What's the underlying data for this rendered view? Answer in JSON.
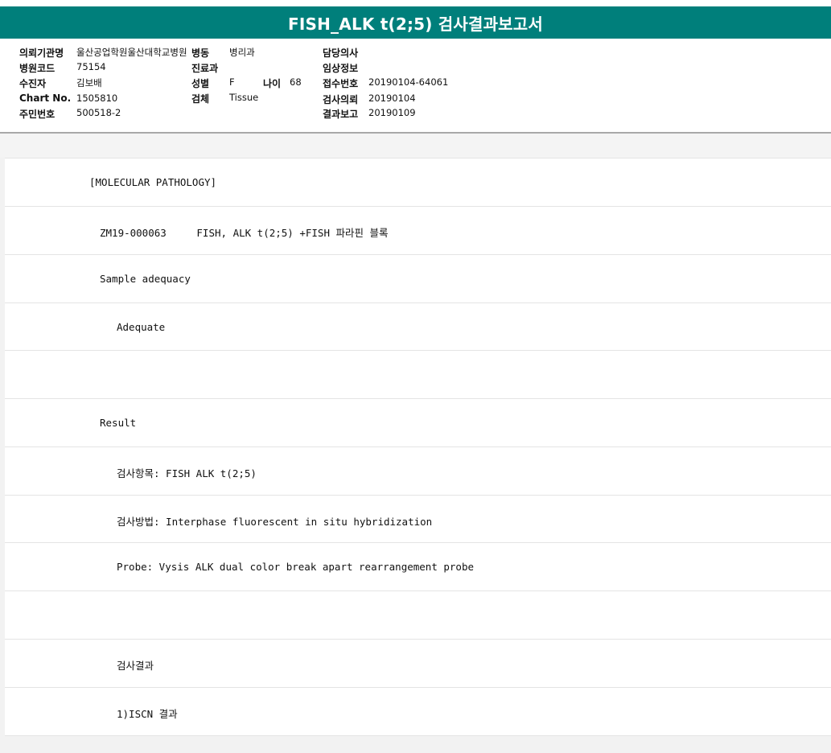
{
  "report": {
    "title": "FISH_ALK t(2;5) 검사결과보고서"
  },
  "header_info": {
    "col1": [
      {
        "label": "의뢰기관명",
        "value": "울산공업학원울산대학교병원"
      },
      {
        "label": "병원코드",
        "value": "75154"
      },
      {
        "label": "수진자",
        "value": "김보배"
      },
      {
        "label": "Chart No.",
        "value": "1505810"
      },
      {
        "label": "주민번호",
        "value": "500518-2"
      }
    ],
    "col2": {
      "ward_label": "병동",
      "ward_value": "병리과",
      "dept_label": "진료과",
      "dept_value": "",
      "sex_label": "성별",
      "sex_value": "F",
      "age_label": "나이",
      "age_value": "68",
      "specimen_label": "검체",
      "specimen_value": "Tissue"
    },
    "col3": [
      {
        "label": "담당의사",
        "value": ""
      },
      {
        "label": "임상정보",
        "value": ""
      },
      {
        "label": "접수번호",
        "value": "20190104-64061"
      },
      {
        "label": "검사의뢰",
        "value": "20190104"
      },
      {
        "label": "결과보고",
        "value": "20190109"
      }
    ]
  },
  "results": {
    "lines": [
      "[MOLECULAR PATHOLOGY]",
      "ZM19-000063     FISH, ALK t(2;5) +FISH 파라핀 블록",
      "Sample adequacy",
      "Adequate",
      "",
      "Result",
      "검사항목: FISH ALK t(2;5)",
      "검사방법: Interphase fluorescent in situ hybridization",
      "Probe: Vysis ALK dual color break apart rearrangement probe",
      "",
      "검사결과",
      "1)ISCN 결과"
    ]
  }
}
